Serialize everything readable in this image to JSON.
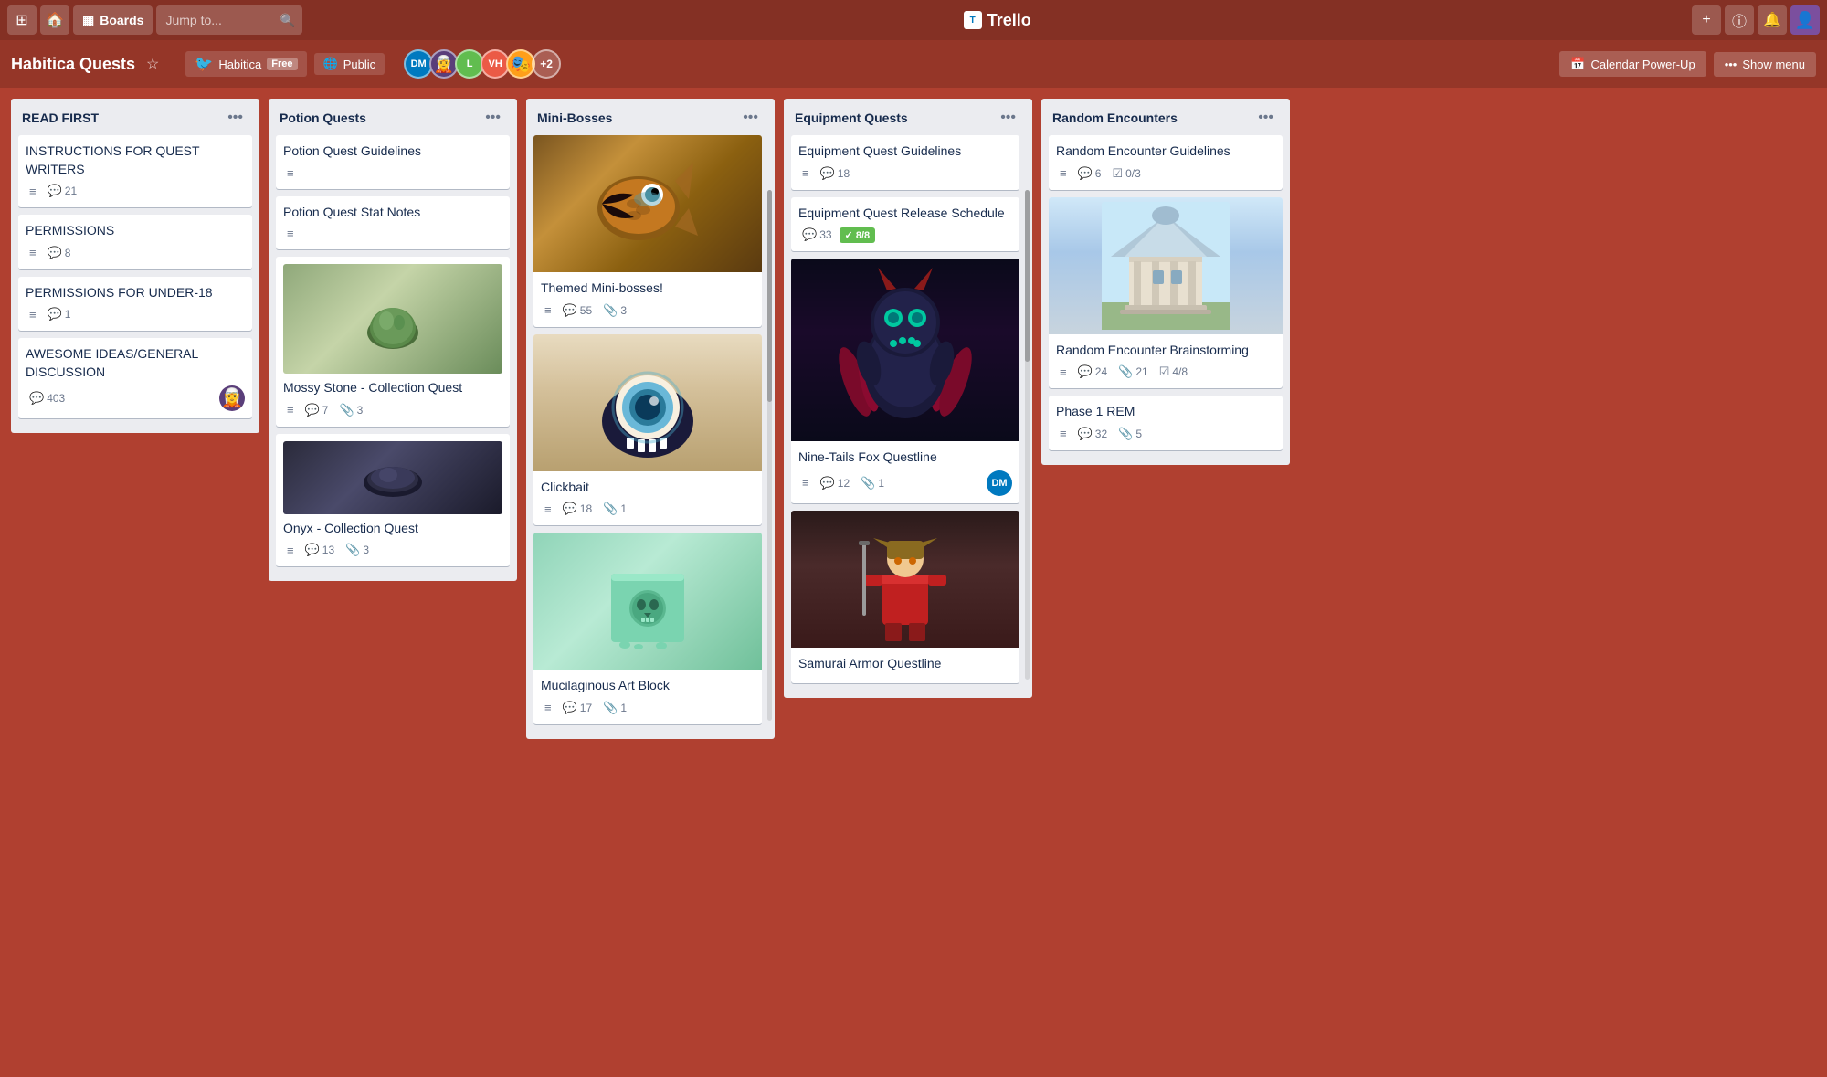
{
  "topNav": {
    "searchPlaceholder": "Jump to...",
    "logoText": "Trello",
    "boardsLabel": "Boards"
  },
  "boardHeader": {
    "title": "Habitica Quests",
    "workspaceLabel": "Habitica",
    "freeTag": "Free",
    "visibilityLabel": "Public",
    "calendarLabel": "Calendar Power-Up",
    "showMenuLabel": "Show menu",
    "avatars": [
      "DM",
      "L",
      "VH",
      "+2"
    ]
  },
  "columns": [
    {
      "id": "read-first",
      "title": "READ FIRST",
      "cards": [
        {
          "id": "instructions",
          "title": "INSTRUCTIONS FOR QUEST WRITERS",
          "badges": [
            {
              "icon": "≡",
              "type": "description"
            },
            {
              "icon": "💬",
              "count": "21"
            }
          ]
        },
        {
          "id": "permissions",
          "title": "PERMISSIONS",
          "badges": [
            {
              "icon": "≡",
              "type": "description"
            },
            {
              "icon": "💬",
              "count": "8"
            }
          ]
        },
        {
          "id": "permissions-under18",
          "title": "PERMISSIONS FOR UNDER-18",
          "badges": [
            {
              "icon": "≡",
              "type": "description"
            },
            {
              "icon": "💬",
              "count": "1"
            }
          ]
        },
        {
          "id": "awesome-ideas",
          "title": "AWESOME IDEAS/GENERAL DISCUSSION",
          "badges": [
            {
              "icon": "💬",
              "count": "403"
            }
          ],
          "hasAvatar": true
        }
      ]
    },
    {
      "id": "potion-quests",
      "title": "Potion Quests",
      "cards": [
        {
          "id": "potion-guidelines",
          "title": "Potion Quest Guidelines",
          "badges": [
            {
              "icon": "≡",
              "type": "description"
            }
          ]
        },
        {
          "id": "potion-stat-notes",
          "title": "Potion Quest Stat Notes",
          "badges": [
            {
              "icon": "≡",
              "type": "description"
            }
          ]
        },
        {
          "id": "mossy-stone",
          "title": "Mossy Stone - Collection Quest",
          "hasImage": "mossy-stone",
          "badges": [
            {
              "icon": "≡",
              "type": "description"
            },
            {
              "icon": "💬",
              "count": "7"
            },
            {
              "icon": "📎",
              "count": "3"
            }
          ]
        },
        {
          "id": "onyx",
          "title": "Onyx - Collection Quest",
          "hasImage": "onyx",
          "badges": [
            {
              "icon": "≡",
              "type": "description"
            },
            {
              "icon": "💬",
              "count": "13"
            },
            {
              "icon": "📎",
              "count": "3"
            }
          ]
        }
      ]
    },
    {
      "id": "mini-bosses",
      "title": "Mini-Bosses",
      "hasScrollbar": true,
      "cards": [
        {
          "id": "themed-mini-bosses",
          "title": "Themed Mini-bosses!",
          "hasImage": "mini-boss",
          "badges": [
            {
              "icon": "≡",
              "type": "description"
            },
            {
              "icon": "💬",
              "count": "55"
            },
            {
              "icon": "📎",
              "count": "3"
            }
          ]
        },
        {
          "id": "clickbait",
          "title": "Clickbait",
          "hasImage": "clickbait",
          "badges": [
            {
              "icon": "≡",
              "type": "description"
            },
            {
              "icon": "💬",
              "count": "18"
            },
            {
              "icon": "📎",
              "count": "1"
            }
          ]
        },
        {
          "id": "mucilaginous-art-block",
          "title": "Mucilaginous Art Block",
          "hasImage": "slime",
          "badges": [
            {
              "icon": "≡",
              "type": "description"
            },
            {
              "icon": "💬",
              "count": "17"
            },
            {
              "icon": "📎",
              "count": "1"
            }
          ]
        }
      ]
    },
    {
      "id": "equipment-quests",
      "title": "Equipment Quests",
      "hasScrollbar": true,
      "cards": [
        {
          "id": "equipment-guidelines",
          "title": "Equipment Quest Guidelines",
          "badges": [
            {
              "icon": "≡",
              "type": "description"
            },
            {
              "icon": "💬",
              "count": "18"
            }
          ]
        },
        {
          "id": "equipment-release-schedule",
          "title": "Equipment Quest Release Schedule",
          "badges": [
            {
              "icon": "💬",
              "count": "33"
            },
            {
              "icon": "✅",
              "count": "8/8",
              "isGreen": true
            }
          ]
        },
        {
          "id": "nine-tails",
          "title": "Nine-Tails Fox Questline",
          "hasImage": "demon",
          "badges": [
            {
              "icon": "≡",
              "type": "description"
            },
            {
              "icon": "💬",
              "count": "12"
            },
            {
              "icon": "📎",
              "count": "1"
            }
          ],
          "hasAvatar": "DM"
        },
        {
          "id": "samurai-armor",
          "title": "Samurai Armor Questline",
          "hasImage": "samurai"
        }
      ]
    },
    {
      "id": "random-encounters",
      "title": "Random Encounters",
      "cards": [
        {
          "id": "random-encounter-guidelines",
          "title": "Random Encounter Guidelines",
          "badges": [
            {
              "icon": "≡",
              "type": "description"
            },
            {
              "icon": "💬",
              "count": "6"
            },
            {
              "icon": "☑",
              "count": "0/3"
            }
          ]
        },
        {
          "id": "random-encounter-brainstorming",
          "title": "Random Encounter Brainstorming",
          "hasImage": "building",
          "badges": [
            {
              "icon": "≡",
              "type": "description"
            },
            {
              "icon": "💬",
              "count": "24"
            },
            {
              "icon": "📎",
              "count": "21"
            },
            {
              "icon": "☑",
              "count": "4/8"
            }
          ]
        },
        {
          "id": "phase1-rem",
          "title": "Phase 1 REM",
          "badges": [
            {
              "icon": "≡",
              "type": "description"
            },
            {
              "icon": "💬",
              "count": "32"
            },
            {
              "icon": "📎",
              "count": "5"
            }
          ]
        }
      ]
    }
  ]
}
